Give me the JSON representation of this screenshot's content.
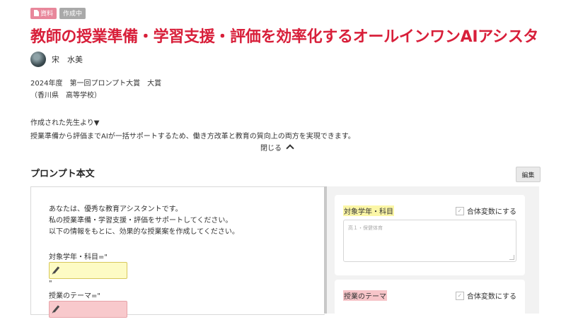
{
  "badges": {
    "first": "資料",
    "second": "作成中"
  },
  "title": "教師の授業準備・学習支援・評価を効率化するオールインワンAIアシスタ",
  "author": {
    "name": "宋　水美"
  },
  "award": {
    "line1": "2024年度　第一回プロンプト大賞　大賞",
    "line2": "（香川県　高等学校）"
  },
  "from_teacher": {
    "heading": "作成された先生より▼",
    "body": "授業準備から評価までAIが一括サポートするため、働き方改革と教育の質向上の両方を実現できます。"
  },
  "toggle": {
    "label": "閉じる"
  },
  "section": {
    "title": "プロンプト本文",
    "edit_label": "編集"
  },
  "prompt": {
    "lines": [
      "あなたは、優秀な教育アシスタントです。",
      "私の授業準備・学習支援・評価をサポートしてください。",
      "以下の情報をもとに、効果的な授業案を作成してください。"
    ],
    "var1_label": "対象学年・科目=\"",
    "var1_close": "\"",
    "var2_label": "授業のテーマ=\""
  },
  "form": {
    "card1": {
      "label": "対象学年・科目",
      "checkbox": "合体変数にする",
      "placeholder": "高１・保健体育"
    },
    "card2": {
      "label": "授業のテーマ",
      "checkbox": "合体変数にする"
    }
  },
  "colors": {
    "accent": "#d81f3a",
    "var_yellow": "#fdfbc4",
    "var_pink": "#f8c9cc"
  },
  "icons": {
    "doc": "document-icon",
    "chevron": "chevron-up-icon",
    "pencil": "pencil-icon",
    "check": "checkbox-icon"
  }
}
